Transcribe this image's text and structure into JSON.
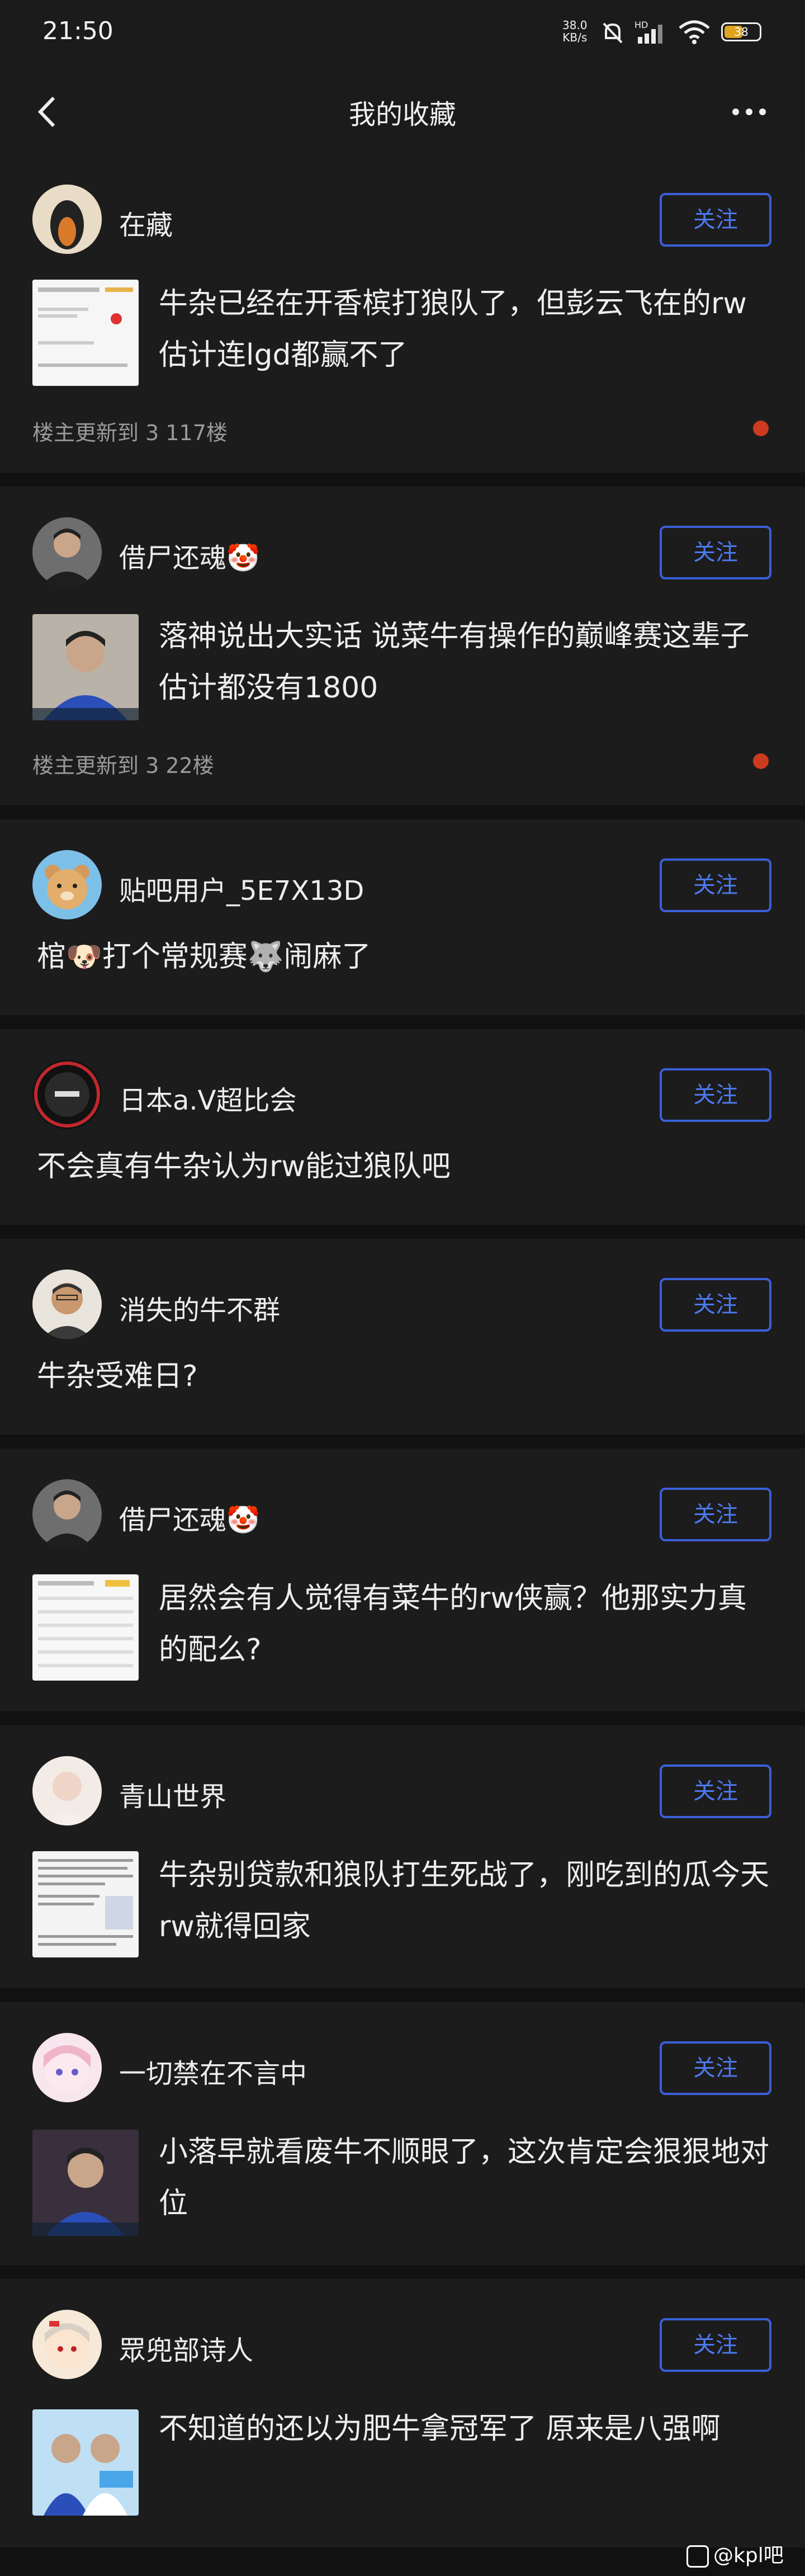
{
  "status": {
    "time": "21:50",
    "speed_top": "38.0",
    "speed_bottom": "KB/s",
    "battery": "38"
  },
  "nav": {
    "title": "我的收藏"
  },
  "posts": [
    {
      "user": "在藏",
      "follow": "关注",
      "text": "牛杂已经在开香槟打狼队了，但彭云飞在的rw估计连lgd都赢不了",
      "meta": "楼主更新到 3 117楼"
    },
    {
      "user": "借尸还魂🤡",
      "follow": "关注",
      "text": "落神说出大实话 说菜牛有操作的巅峰赛这辈子估计都没有1800",
      "meta": "楼主更新到 3 22楼"
    },
    {
      "user": "贴吧用户_5E7X13D",
      "follow": "关注",
      "text": "棺🐶打个常规赛🐺闹麻了"
    },
    {
      "user": "日本a.V超比会",
      "follow": "关注",
      "text": "不会真有牛杂认为rw能过狼队吧"
    },
    {
      "user": "消失的牛不群",
      "follow": "关注",
      "text": "牛杂受难日?"
    },
    {
      "user": "借尸还魂🤡",
      "follow": "关注",
      "text": "居然会有人觉得有菜牛的rw侠赢？他那实力真的配么?"
    },
    {
      "user": "青山世界",
      "follow": "关注",
      "text": "牛杂别贷款和狼队打生死战了，刚吃到的瓜今天rw就得回家"
    },
    {
      "user": "一切禁在不言中",
      "follow": "关注",
      "text": "小落早就看废牛不顺眼了，这次肯定会狠狠地对位"
    },
    {
      "user": "眾兜部诗人",
      "follow": "关注",
      "text": "不知道的还以为肥牛拿冠军了 原来是八强啊"
    }
  ],
  "watermark": "@kpl吧",
  "colors": {
    "bg": "#111111",
    "card": "#1c1c1c",
    "accent": "#3b5fd8",
    "dot": "#cc3b1f"
  }
}
